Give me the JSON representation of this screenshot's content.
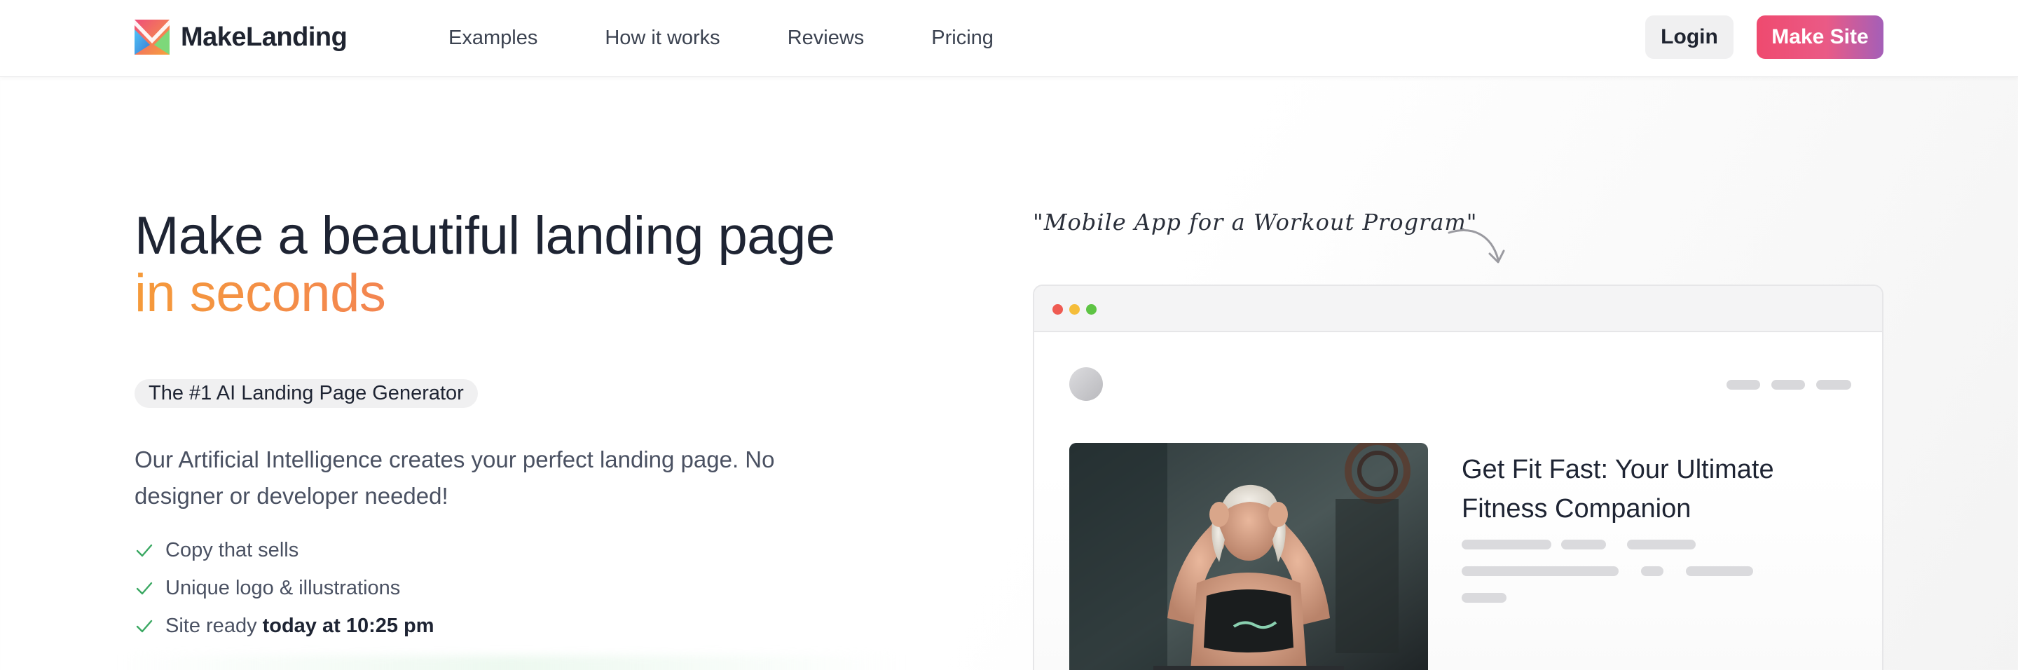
{
  "header": {
    "brand": "MakeLanding",
    "nav": [
      {
        "label": "Examples"
      },
      {
        "label": "How it works"
      },
      {
        "label": "Reviews"
      },
      {
        "label": "Pricing"
      }
    ],
    "login_label": "Login",
    "cta_label": "Make Site"
  },
  "hero": {
    "title_line1": "Make a beautiful landing page",
    "title_line2": "in seconds",
    "badge": "The #1 AI Landing Page Generator",
    "description": "Our Artificial Intelligence creates your perfect landing page. No designer or developer needed!",
    "features": [
      {
        "text": "Copy that sells"
      },
      {
        "text": "Unique logo & illustrations"
      },
      {
        "text": "Site ready",
        "bold": "today at 10:25 pm"
      }
    ]
  },
  "preview": {
    "prompt": "\"Mobile App for a Workout Program\"",
    "site_title": "Get Fit Fast: Your Ultimate Fitness Companion"
  },
  "colors": {
    "brand_gradient_start": "#ef4a6f",
    "brand_gradient_end": "#a45fb8",
    "accent_orange": "#f59a3a",
    "check_green": "#3aa862"
  },
  "icons": {
    "logo": "envelope-m-logo-icon",
    "check": "check-icon",
    "arrow": "curved-arrow-icon"
  }
}
